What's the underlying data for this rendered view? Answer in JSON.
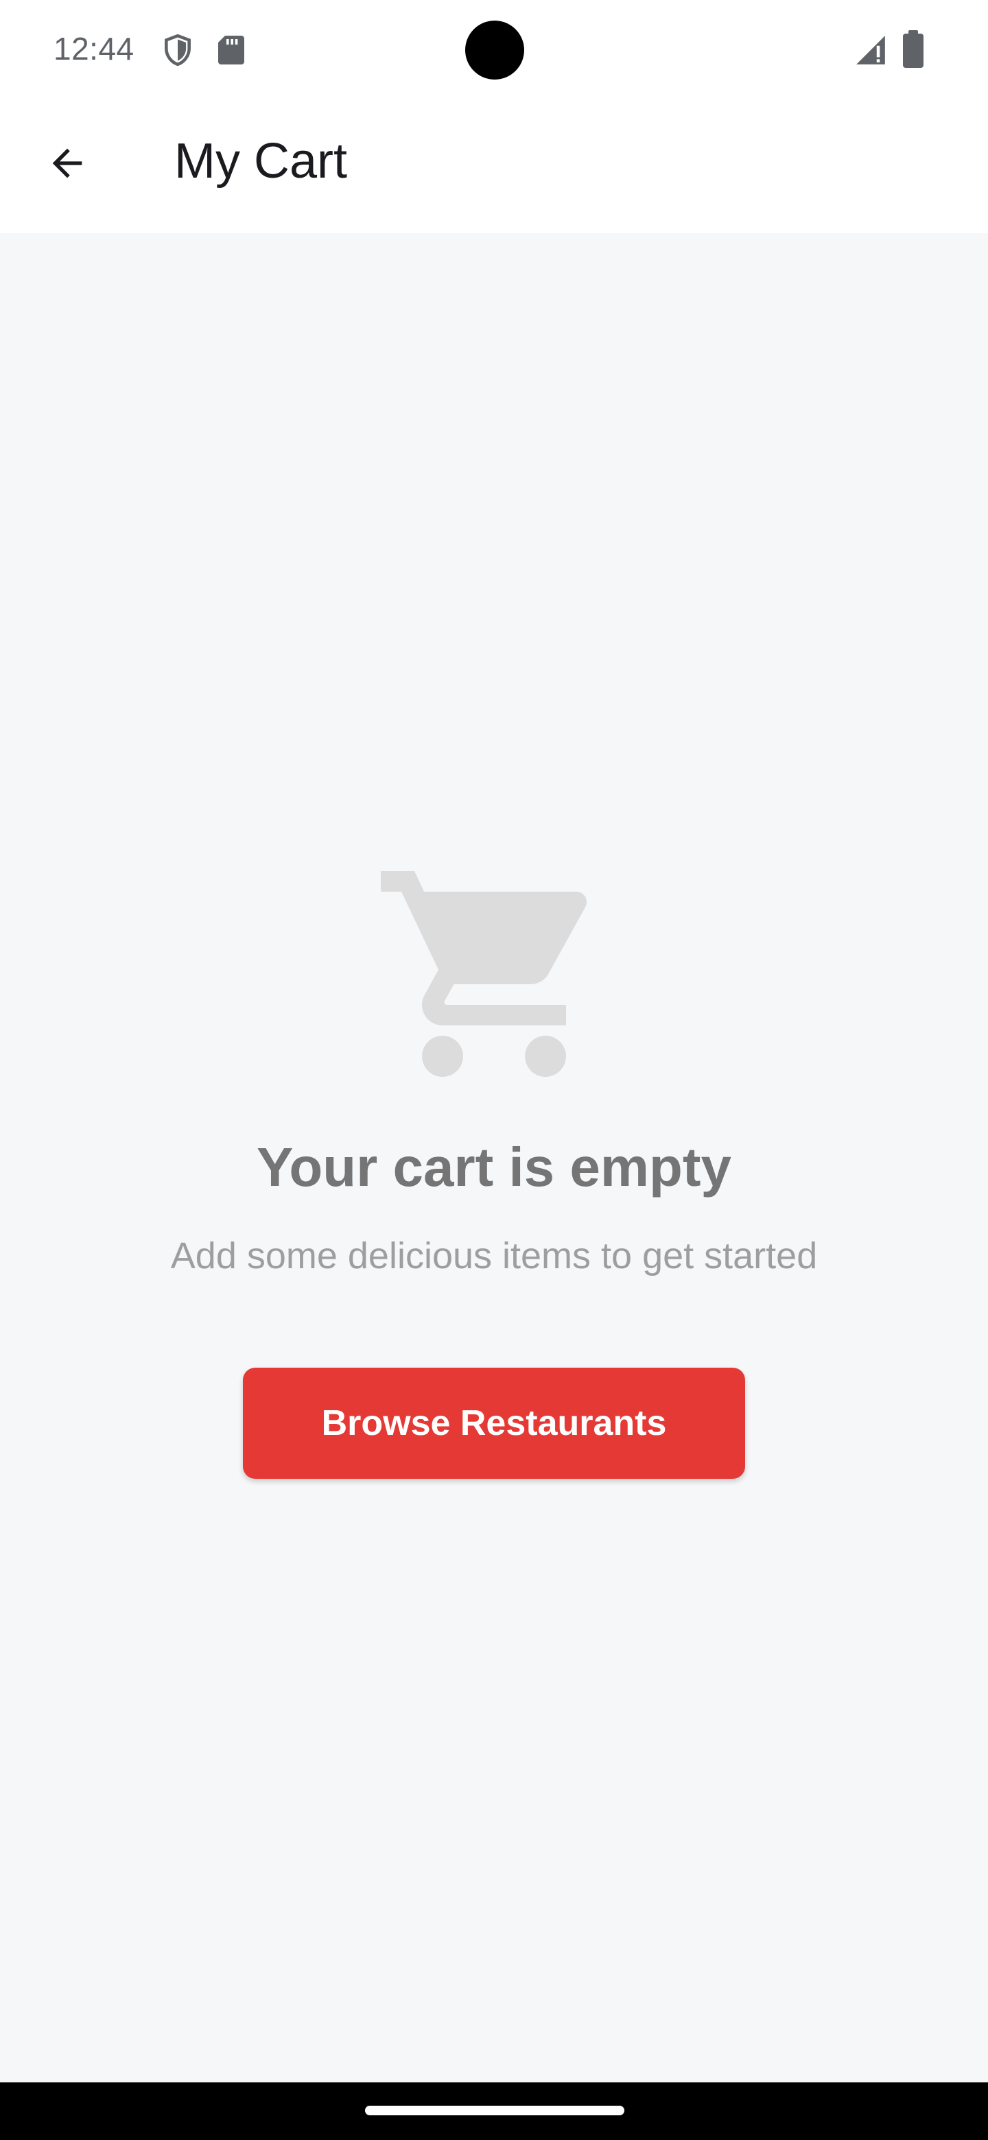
{
  "status_bar": {
    "time": "12:44",
    "icons": [
      "shield-icon",
      "sd-card-icon",
      "signal-icon",
      "battery-icon"
    ]
  },
  "app_bar": {
    "title": "My Cart",
    "back_icon": "arrow-back-icon"
  },
  "empty_state": {
    "icon": "shopping-cart-icon",
    "title": "Your cart is empty",
    "subtitle": "Add some delicious items to get started",
    "button_label": "Browse Restaurants"
  },
  "colors": {
    "accent": "#e53935",
    "background": "#f6f7f9",
    "icon_gray": "#dcdcdc",
    "title_gray": "#757575",
    "subtitle_gray": "#9e9e9e"
  }
}
